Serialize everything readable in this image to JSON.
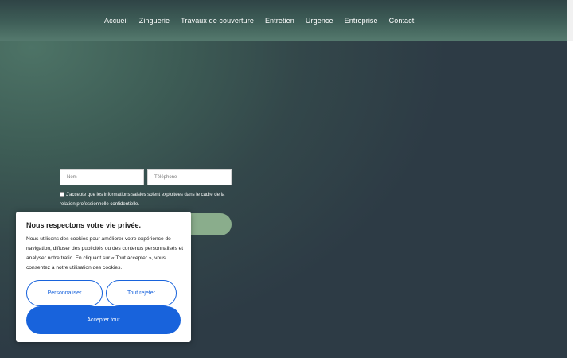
{
  "nav": {
    "items": [
      {
        "label": "Accueil"
      },
      {
        "label": "Zinguerie"
      },
      {
        "label": "Travaux de couverture"
      },
      {
        "label": "Entretien"
      },
      {
        "label": "Urgence"
      },
      {
        "label": "Entreprise"
      },
      {
        "label": "Contact"
      }
    ]
  },
  "form": {
    "name_placeholder": "Nom",
    "phone_placeholder": "Téléphone",
    "consent_text": "J'accepte que les informations saisies soient exploitées dans le cadre de la relation professionnelle confidentielle."
  },
  "cookie_banner": {
    "title": "Nous respectons votre vie privée.",
    "body": "Nous utilisons des cookies pour améliorer votre expérience de navigation, diffuser des publicités ou des contenus personnalisés et analyser notre trafic. En cliquant sur « Tout accepter », vous consentez à notre utilisation des cookies.",
    "customize_label": "Personnaliser",
    "reject_label": "Tout rejeter",
    "accept_label": "Accepter tout"
  },
  "colors": {
    "accent": "#1863dc",
    "submit_green": "#8aad8c",
    "background_dark": "#2d3b45",
    "background_green": "#4d7366"
  }
}
